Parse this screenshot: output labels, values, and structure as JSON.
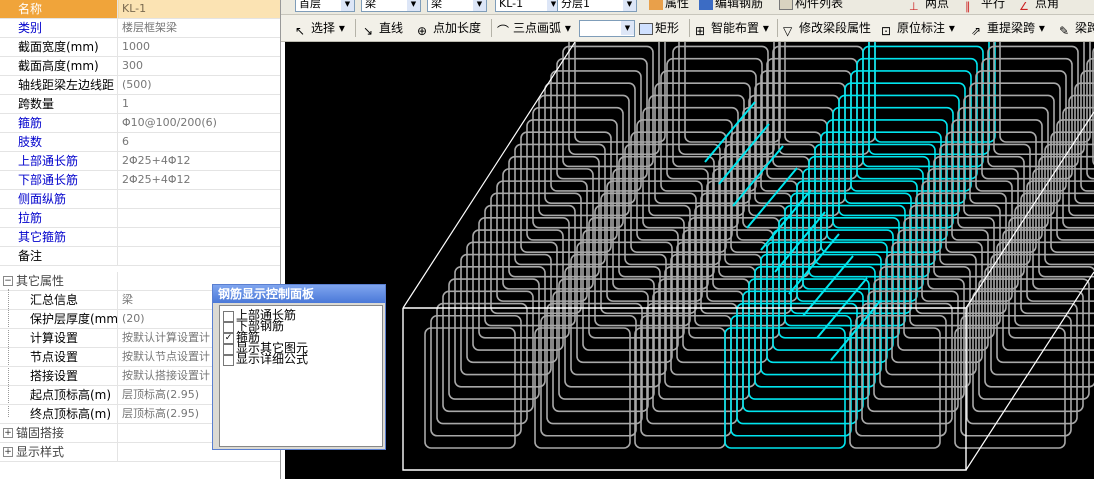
{
  "properties": {
    "header": {
      "name": "名称",
      "value": "KL-1"
    },
    "rows": [
      {
        "name": "类别",
        "value": "楼层框架梁",
        "blue": true
      },
      {
        "name": "截面宽度(mm)",
        "value": "1000",
        "blue": false
      },
      {
        "name": "截面高度(mm)",
        "value": "300",
        "blue": false
      },
      {
        "name": "轴线距梁左边线距",
        "value": "(500)",
        "blue": false
      },
      {
        "name": "跨数量",
        "value": "1",
        "blue": false
      },
      {
        "name": "箍筋",
        "value": "Φ10@100/200(6)",
        "blue": true
      },
      {
        "name": "肢数",
        "value": "6",
        "blue": true
      },
      {
        "name": "上部通长筋",
        "value": "2Φ25+4Φ12",
        "blue": true
      },
      {
        "name": "下部通长筋",
        "value": "2Φ25+4Φ12",
        "blue": true
      },
      {
        "name": "侧面纵筋",
        "value": "",
        "blue": true
      },
      {
        "name": "拉筋",
        "value": "",
        "blue": true
      },
      {
        "name": "其它箍筋",
        "value": "",
        "blue": true
      },
      {
        "name": "备注",
        "value": "",
        "blue": false
      }
    ],
    "other_group": {
      "label": "其它属性",
      "expander": "−"
    },
    "other_rows": [
      {
        "name": "汇总信息",
        "value": "梁"
      },
      {
        "name": "保护层厚度(mm)",
        "value": "(20)"
      },
      {
        "name": "计算设置",
        "value": "按默认计算设置计"
      },
      {
        "name": "节点设置",
        "value": "按默认节点设置计"
      },
      {
        "name": "搭接设置",
        "value": "按默认搭接设置计"
      },
      {
        "name": "起点顶标高(m)",
        "value": "层顶标高(2.95)"
      },
      {
        "name": "终点顶标高(m)",
        "value": "层顶标高(2.95)"
      }
    ],
    "groups_bottom": [
      {
        "label": "锚固搭接",
        "expander": "+"
      },
      {
        "label": "显示样式",
        "expander": "+"
      }
    ]
  },
  "toolbar_top": {
    "combo_floor": "首层",
    "combo_type": "梁",
    "combo_type2": "梁",
    "combo_member": "KL-1",
    "combo_layer": "分层1",
    "btn_props": "属性",
    "btn_edit_rebar": "编辑钢筋",
    "btn_list": "构件列表",
    "btn_two_points": "两点",
    "btn_parallel": "平行",
    "btn_point_angle": "点角"
  },
  "toolbar_main": {
    "select": "选择",
    "line": "直线",
    "point_length": "点加长度",
    "arc": "三点画弧",
    "rect": "矩形",
    "smart_layout": "智能布置",
    "modify_span": "修改梁段属性",
    "annotate": "原位标注",
    "redo_span": "重提梁跨",
    "beam_span": "梁跨"
  },
  "panel": {
    "title": "钢筋显示控制面板",
    "items": [
      {
        "label": "上部通长筋",
        "checked": false
      },
      {
        "label": "下部钢筋",
        "checked": false
      },
      {
        "label": "箍筋",
        "checked": true
      },
      {
        "label": "显示其它图元",
        "checked": false
      },
      {
        "label": "显示详细公式",
        "checked": false
      }
    ]
  },
  "colors": {
    "stirrup_gray": "#a8a8a8",
    "stirrup_cyan": "#00e5ee",
    "background": "#000000"
  }
}
